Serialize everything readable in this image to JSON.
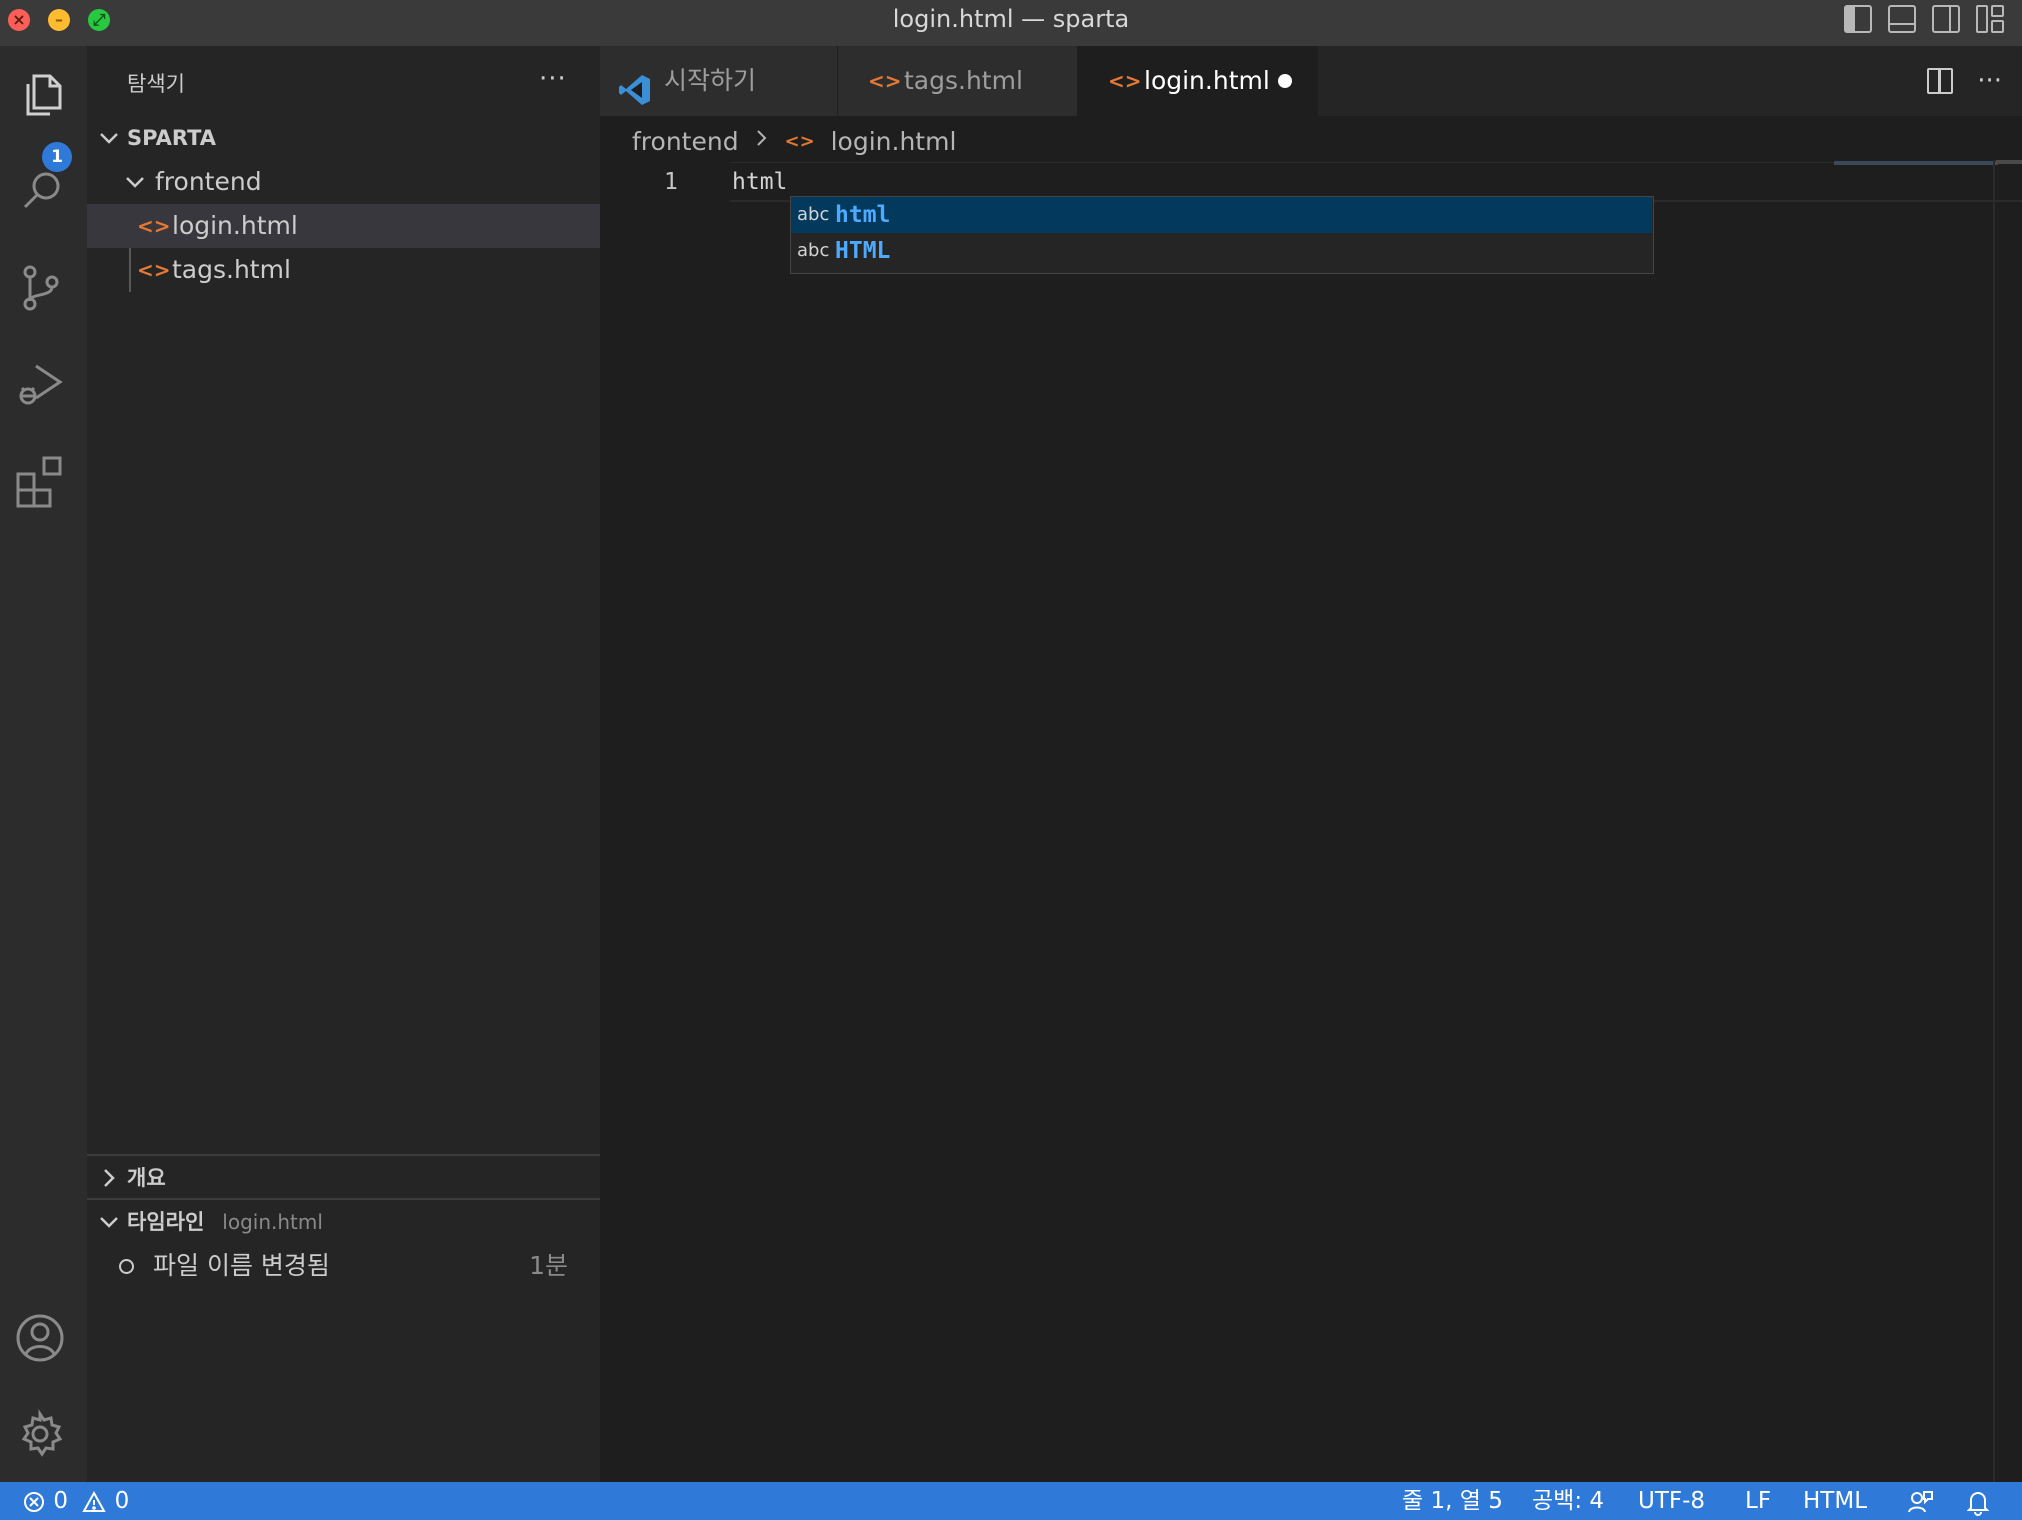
{
  "window": {
    "title": "login.html — sparta",
    "close_glyph": "×",
    "minimize_glyph": "–",
    "maximize_glyph": "⤢"
  },
  "activity_bar": {
    "explorer_badge": "1",
    "items": [
      "explorer-icon",
      "search-icon",
      "source-control-icon",
      "run-debug-icon",
      "extensions-icon"
    ],
    "bottom": [
      "account-icon",
      "settings-gear-icon"
    ]
  },
  "sidebar": {
    "title": "탐색기",
    "more": "···",
    "workspace": "SPARTA",
    "folder": "frontend",
    "files": [
      {
        "name": "login.html",
        "selected": true
      },
      {
        "name": "tags.html",
        "selected": false
      }
    ],
    "file_icon_glyph": "<>",
    "outline_label": "개요",
    "timeline_label": "타임라인",
    "timeline_file": "login.html",
    "timeline_entry": "파일 이름 변경됨",
    "timeline_time": "1분"
  },
  "tabs": [
    {
      "label": "시작하기",
      "icon": "vscode-logo-icon",
      "active": false
    },
    {
      "label": "tags.html",
      "icon": "html-file-icon",
      "active": false
    },
    {
      "label": "login.html",
      "icon": "html-file-icon",
      "active": true,
      "dirty": true
    }
  ],
  "editor": {
    "breadcrumb_folder": "frontend",
    "breadcrumb_file": "login.html",
    "line_number": "1",
    "line_text": "html",
    "more": "···"
  },
  "suggest": {
    "items": [
      {
        "kind": "abc",
        "label": "html",
        "focused": true
      },
      {
        "kind": "abc",
        "label": "HTML",
        "focused": false
      }
    ]
  },
  "statusbar": {
    "errors": "0",
    "warnings": "0",
    "position": "줄 1, 열 5",
    "indent": "공백: 4",
    "encoding": "UTF-8",
    "eol": "LF",
    "language": "HTML",
    "accent": "#2f7ad8"
  }
}
